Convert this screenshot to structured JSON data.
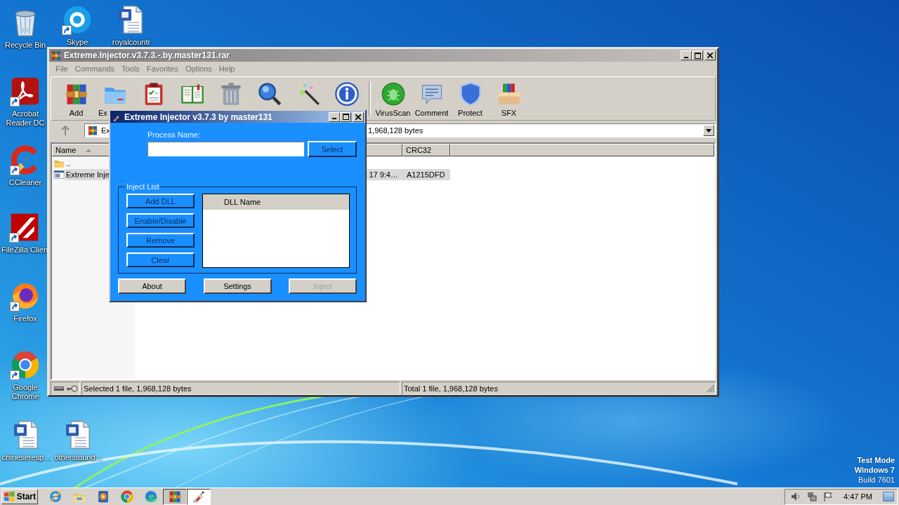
{
  "desktop_icons": [
    {
      "label": "Recycle Bin",
      "kind": "recycle",
      "shortcut": false
    },
    {
      "label": "Skype",
      "kind": "skype",
      "shortcut": true
    },
    {
      "label": "royalcountr",
      "kind": "word",
      "shortcut": false
    },
    {
      "label": "Acrobat Reader DC",
      "kind": "acrobat",
      "shortcut": true
    },
    {
      "label": "CCleaner",
      "kind": "ccleaner",
      "shortcut": true
    },
    {
      "label": "FileZilla Clien",
      "kind": "filezilla",
      "shortcut": true
    },
    {
      "label": "Firefox",
      "kind": "firefox",
      "shortcut": true
    },
    {
      "label": "Google Chrome",
      "kind": "chrome",
      "shortcut": true
    },
    {
      "label": "chineseresp…",
      "kind": "word",
      "shortcut": false
    },
    {
      "label": "othersfound…",
      "kind": "word",
      "shortcut": false
    }
  ],
  "archive_window": {
    "title": "Extreme.Injector.v3.7.3.-.by.master131.rar",
    "menu": [
      "File",
      "Commands",
      "Tools",
      "Favorites",
      "Options",
      "Help"
    ],
    "toolbar": [
      {
        "kind": "add",
        "label": "Add"
      },
      {
        "kind": "extract",
        "label": "Ex"
      },
      {
        "kind": "test"
      },
      {
        "kind": "view"
      },
      {
        "kind": "delete"
      },
      {
        "kind": "find"
      },
      {
        "kind": "wizard"
      },
      {
        "kind": "info"
      },
      {
        "kind": "separator"
      },
      {
        "kind": "virusscan",
        "label": "VirusScan"
      },
      {
        "kind": "comment",
        "label": "Comment"
      },
      {
        "kind": "protect",
        "label": "Protect"
      },
      {
        "kind": "sfx",
        "label": "SFX"
      }
    ],
    "address": {
      "path": "Ex",
      "details": "1,968,128 bytes"
    },
    "columns": [
      "Name",
      "CRC32"
    ],
    "rows": [
      {
        "kind": "parent",
        "name": "..",
        "selected": false
      },
      {
        "kind": "file",
        "name": "Extreme Inje",
        "modified": "17 9:4…",
        "crc32": "A1215DFD",
        "selected": true
      }
    ],
    "status": [
      "Selected 1 file, 1,968,128 bytes",
      "Total 1 file, 1,968,128 bytes"
    ]
  },
  "injector": {
    "title": "Extreme Injector v3.7.3 by master131",
    "process_label": "Process Name:",
    "select_button": "Select",
    "group_title": "Inject List",
    "list_buttons": [
      "Add DLL",
      "Enable/Disable",
      "Remove",
      "Clear"
    ],
    "list_column": "DLL Name",
    "bottom_buttons": [
      {
        "label": "About",
        "disabled": false
      },
      {
        "label": "Settings",
        "disabled": false
      },
      {
        "label": "Inject",
        "disabled": true
      }
    ]
  },
  "taskbar": {
    "start": "Start",
    "apps": [
      {
        "kind": "ie",
        "running": false,
        "selected": false
      },
      {
        "kind": "explorer",
        "running": false,
        "selected": false
      },
      {
        "kind": "media",
        "running": false,
        "selected": false
      },
      {
        "kind": "chrome",
        "running": false,
        "selected": false
      },
      {
        "kind": "edge",
        "running": false,
        "selected": false
      },
      {
        "kind": "winrar",
        "running": true,
        "selected": false
      },
      {
        "kind": "injector",
        "running": true,
        "selected": true
      }
    ],
    "clock": "4:47 PM"
  },
  "os_notice": [
    "Test Mode",
    "Windows 7",
    "Build 7601"
  ]
}
